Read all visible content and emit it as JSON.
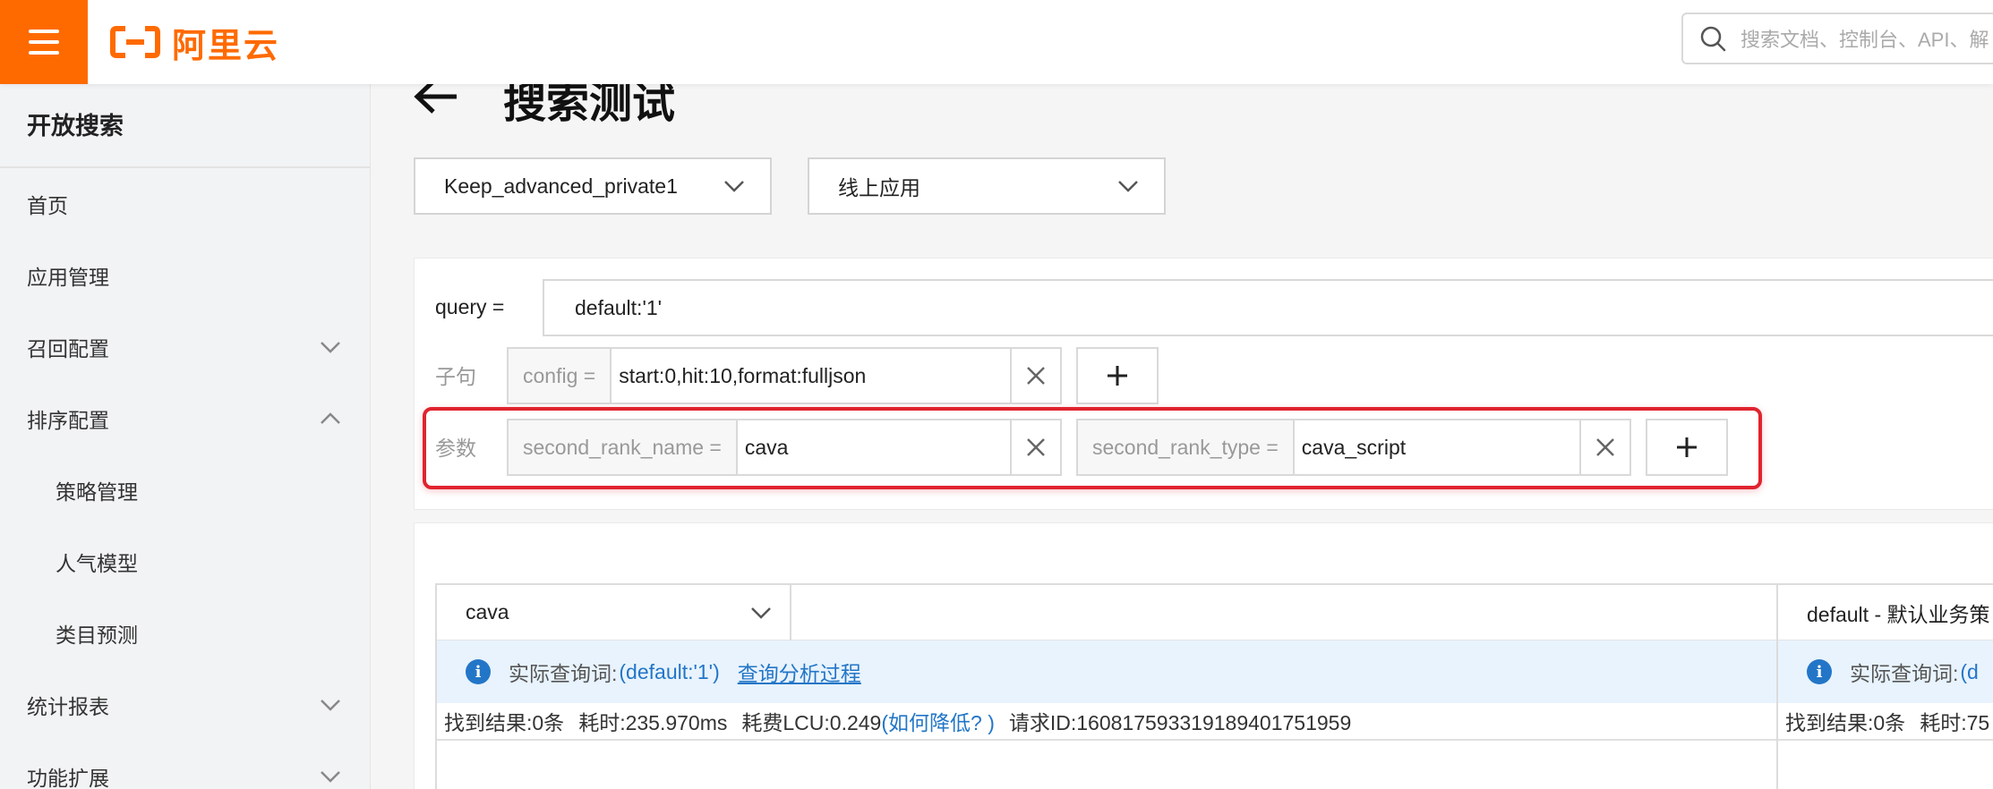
{
  "colors": {
    "brand": "#ff6a00",
    "link": "#2376c7",
    "highlight": "#e0242e",
    "info_bg": "#e8f3fd"
  },
  "topbar": {
    "logo_text": "阿里云",
    "search_placeholder": "搜索文档、控制台、API、解"
  },
  "sidebar": {
    "title": "开放搜索",
    "items": [
      {
        "label": "首页",
        "icon": ""
      },
      {
        "label": "应用管理",
        "icon": ""
      },
      {
        "label": "召回配置",
        "icon": "chevron-down-icon"
      },
      {
        "label": "排序配置",
        "icon": "chevron-up-icon"
      },
      {
        "label": "策略管理",
        "icon": ""
      },
      {
        "label": "人气模型",
        "icon": ""
      },
      {
        "label": "类目预测",
        "icon": ""
      },
      {
        "label": "统计报表",
        "icon": "chevron-down-icon"
      },
      {
        "label": "功能扩展",
        "icon": "chevron-down-icon"
      }
    ]
  },
  "page": {
    "title": "搜索测试"
  },
  "selectors": {
    "app": "Keep_advanced_private1",
    "env": "线上应用"
  },
  "query": {
    "label": "query =",
    "value": "default:'1'"
  },
  "clause": {
    "label": "子句",
    "key": "config =",
    "value": "start:0,hit:10,format:fulljson"
  },
  "params": {
    "label": "参数",
    "items": [
      {
        "key": "second_rank_name =",
        "value": "cava"
      },
      {
        "key": "second_rank_type =",
        "value": "cava_script"
      }
    ]
  },
  "result_left": {
    "select": "cava",
    "info_prefix": "实际查询词:",
    "info_query": "(default:'1')",
    "info_link": "查询分析过程",
    "stats": {
      "found": "找到结果:0条",
      "time": "耗时:235.970ms",
      "lcu": "耗费LCU:0.249",
      "how": "(如何降低? )",
      "request": "请求ID:160817593319189401751959"
    }
  },
  "result_right": {
    "select": "default - 默认业务策",
    "info_prefix": "实际查询词:",
    "info_query": "(d",
    "stats": {
      "found": "找到结果:0条",
      "time": "耗时:75"
    }
  }
}
